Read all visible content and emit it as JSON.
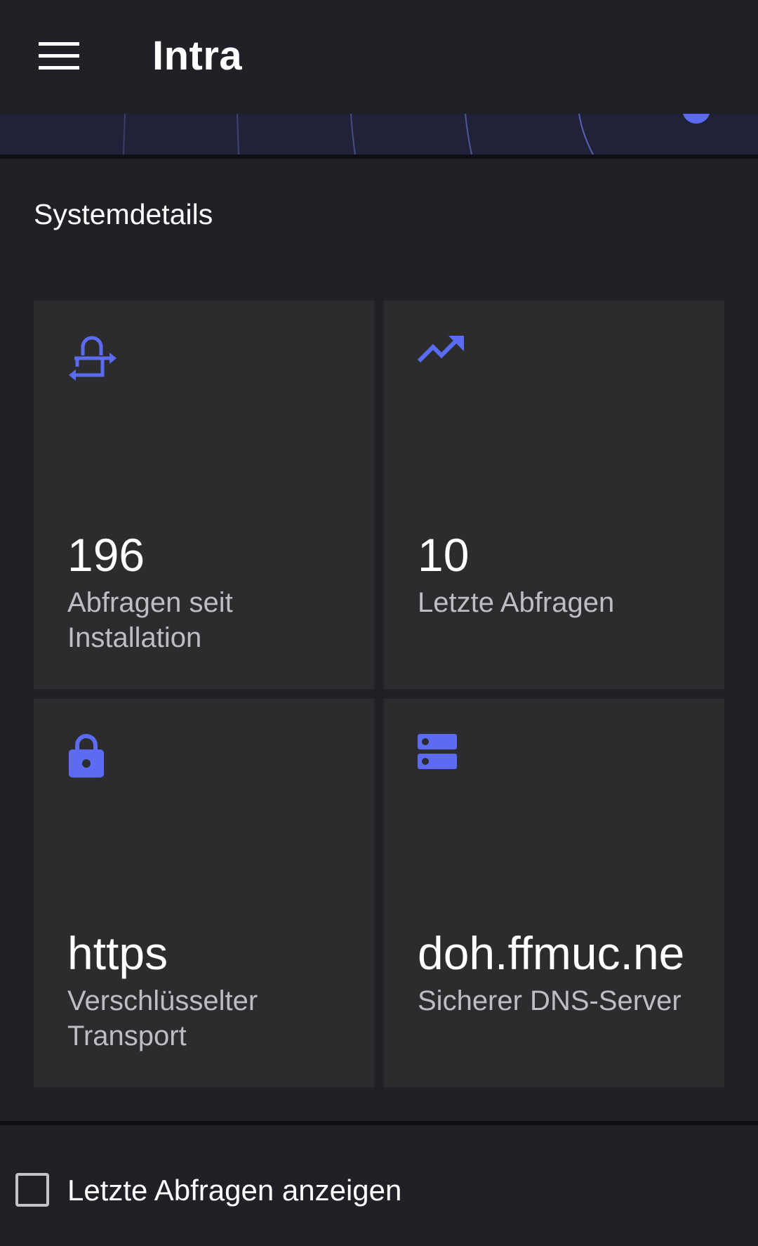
{
  "app": {
    "title": "Intra"
  },
  "icons": {
    "menu": "menu-icon",
    "queries_total": "lock-transfer-icon",
    "recent": "trending-up-icon",
    "transport": "lock-icon",
    "server": "dns-icon"
  },
  "colors": {
    "accent": "#5b6cf2",
    "background": "#202126",
    "card": "#2c2c2e"
  },
  "section": {
    "title": "Systemdetails"
  },
  "cards": [
    {
      "value": "196",
      "label": "Abfragen seit Installation"
    },
    {
      "value": "10",
      "label": "Letzte Abfragen"
    },
    {
      "value": "https",
      "label": "Verschlüsselter Transport"
    },
    {
      "value": "doh.ffmuc.ne",
      "label": "Sicherer DNS-Server"
    }
  ],
  "recent_toggle": {
    "label": "Letzte Abfragen anzeigen",
    "checked": false
  }
}
